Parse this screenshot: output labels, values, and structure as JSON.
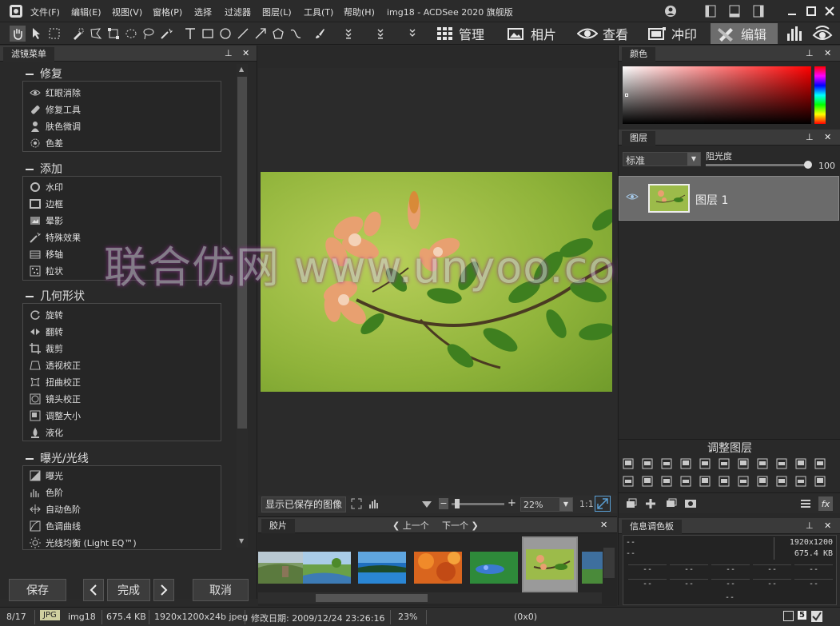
{
  "app": {
    "menus": [
      "文件(F)",
      "编辑(E)",
      "视图(V)",
      "窗格(P)",
      "选择",
      "过滤器",
      "图层(L)",
      "工具(T)",
      "帮助(H)"
    ],
    "title": "img18 - ACDSee 2020 旗舰版"
  },
  "modes": [
    {
      "label": "管理",
      "icon": "grid-icon"
    },
    {
      "label": "相片",
      "icon": "photo-icon"
    },
    {
      "label": "查看",
      "icon": "eye-icon"
    },
    {
      "label": "冲印",
      "icon": "develop-icon"
    },
    {
      "label": "编辑",
      "icon": "edit-tools-icon",
      "active": true
    }
  ],
  "left_panel": {
    "tab": "滤镜菜单",
    "groups": [
      {
        "title": "修复",
        "items": [
          {
            "label": "红眼消除",
            "icon": "eye-icon"
          },
          {
            "label": "修复工具",
            "icon": "bandage-icon"
          },
          {
            "label": "肤色微调",
            "icon": "person-icon"
          },
          {
            "label": "色差",
            "icon": "chromatic-icon"
          }
        ]
      },
      {
        "title": "添加",
        "items": [
          {
            "label": "水印",
            "icon": "stamp-icon"
          },
          {
            "label": "边框",
            "icon": "border-icon"
          },
          {
            "label": "晕影",
            "icon": "vignette-icon"
          },
          {
            "label": "特殊效果",
            "icon": "magic-wand-icon"
          },
          {
            "label": "移轴",
            "icon": "tilt-shift-icon"
          },
          {
            "label": "粒状",
            "icon": "grain-icon"
          }
        ]
      },
      {
        "title": "几何形状",
        "items": [
          {
            "label": "旋转",
            "icon": "rotate-icon"
          },
          {
            "label": "翻转",
            "icon": "flip-icon"
          },
          {
            "label": "裁剪",
            "icon": "crop-icon"
          },
          {
            "label": "透视校正",
            "icon": "perspective-icon"
          },
          {
            "label": "扭曲校正",
            "icon": "distortion-icon"
          },
          {
            "label": "镜头校正",
            "icon": "lens-icon"
          },
          {
            "label": "调整大小",
            "icon": "resize-icon"
          },
          {
            "label": "液化",
            "icon": "liquify-icon"
          }
        ]
      },
      {
        "title": "曝光/光线",
        "items": [
          {
            "label": "曝光",
            "icon": "exposure-icon"
          },
          {
            "label": "色阶",
            "icon": "levels-icon"
          },
          {
            "label": "自动色阶",
            "icon": "auto-levels-icon"
          },
          {
            "label": "色调曲线",
            "icon": "curves-icon"
          },
          {
            "label": "光线均衡 (Light EQ™)",
            "icon": "light-eq-icon"
          }
        ]
      }
    ],
    "buttons": {
      "save": "保存",
      "done": "完成",
      "cancel": "取消"
    }
  },
  "view_bar": {
    "show_saved": "显示已保存的图像",
    "zoom": "22%",
    "ratio": "1:1"
  },
  "filmstrip": {
    "tab": "胶片",
    "prev": "上一个",
    "next": "下一个"
  },
  "right_panel": {
    "color_tab": "颜色",
    "layers_tab": "图层",
    "blend_mode": "标准",
    "opacity_label": "阻光度",
    "opacity_value": "100",
    "opacity": 1.0,
    "layer_name": "图层 1",
    "adjust_layers_label": "调整图层",
    "info_tab": "信息调色板",
    "info": {
      "left1": "--",
      "left2": "--",
      "dims": "1920x1200",
      "size": "675.4 KB",
      "cells": [
        "--",
        "--",
        "--",
        "--",
        "--",
        "--",
        "--",
        "--",
        "--",
        "--"
      ],
      "bottom": "--"
    }
  },
  "status": {
    "index": "8/17",
    "format": "JPG",
    "name": "img18",
    "size": "675.4 KB",
    "dims": "1920x1200x24b jpeg",
    "modified": "修改日期: 2009/12/24 23:26:16",
    "zoom": "23%",
    "coords": "(0x0)",
    "badge": "5"
  },
  "watermark": "联合优网 www.unyoo.com",
  "colors": {
    "accent": "#5a9fd4",
    "active_mode": "#6d6d6d"
  }
}
